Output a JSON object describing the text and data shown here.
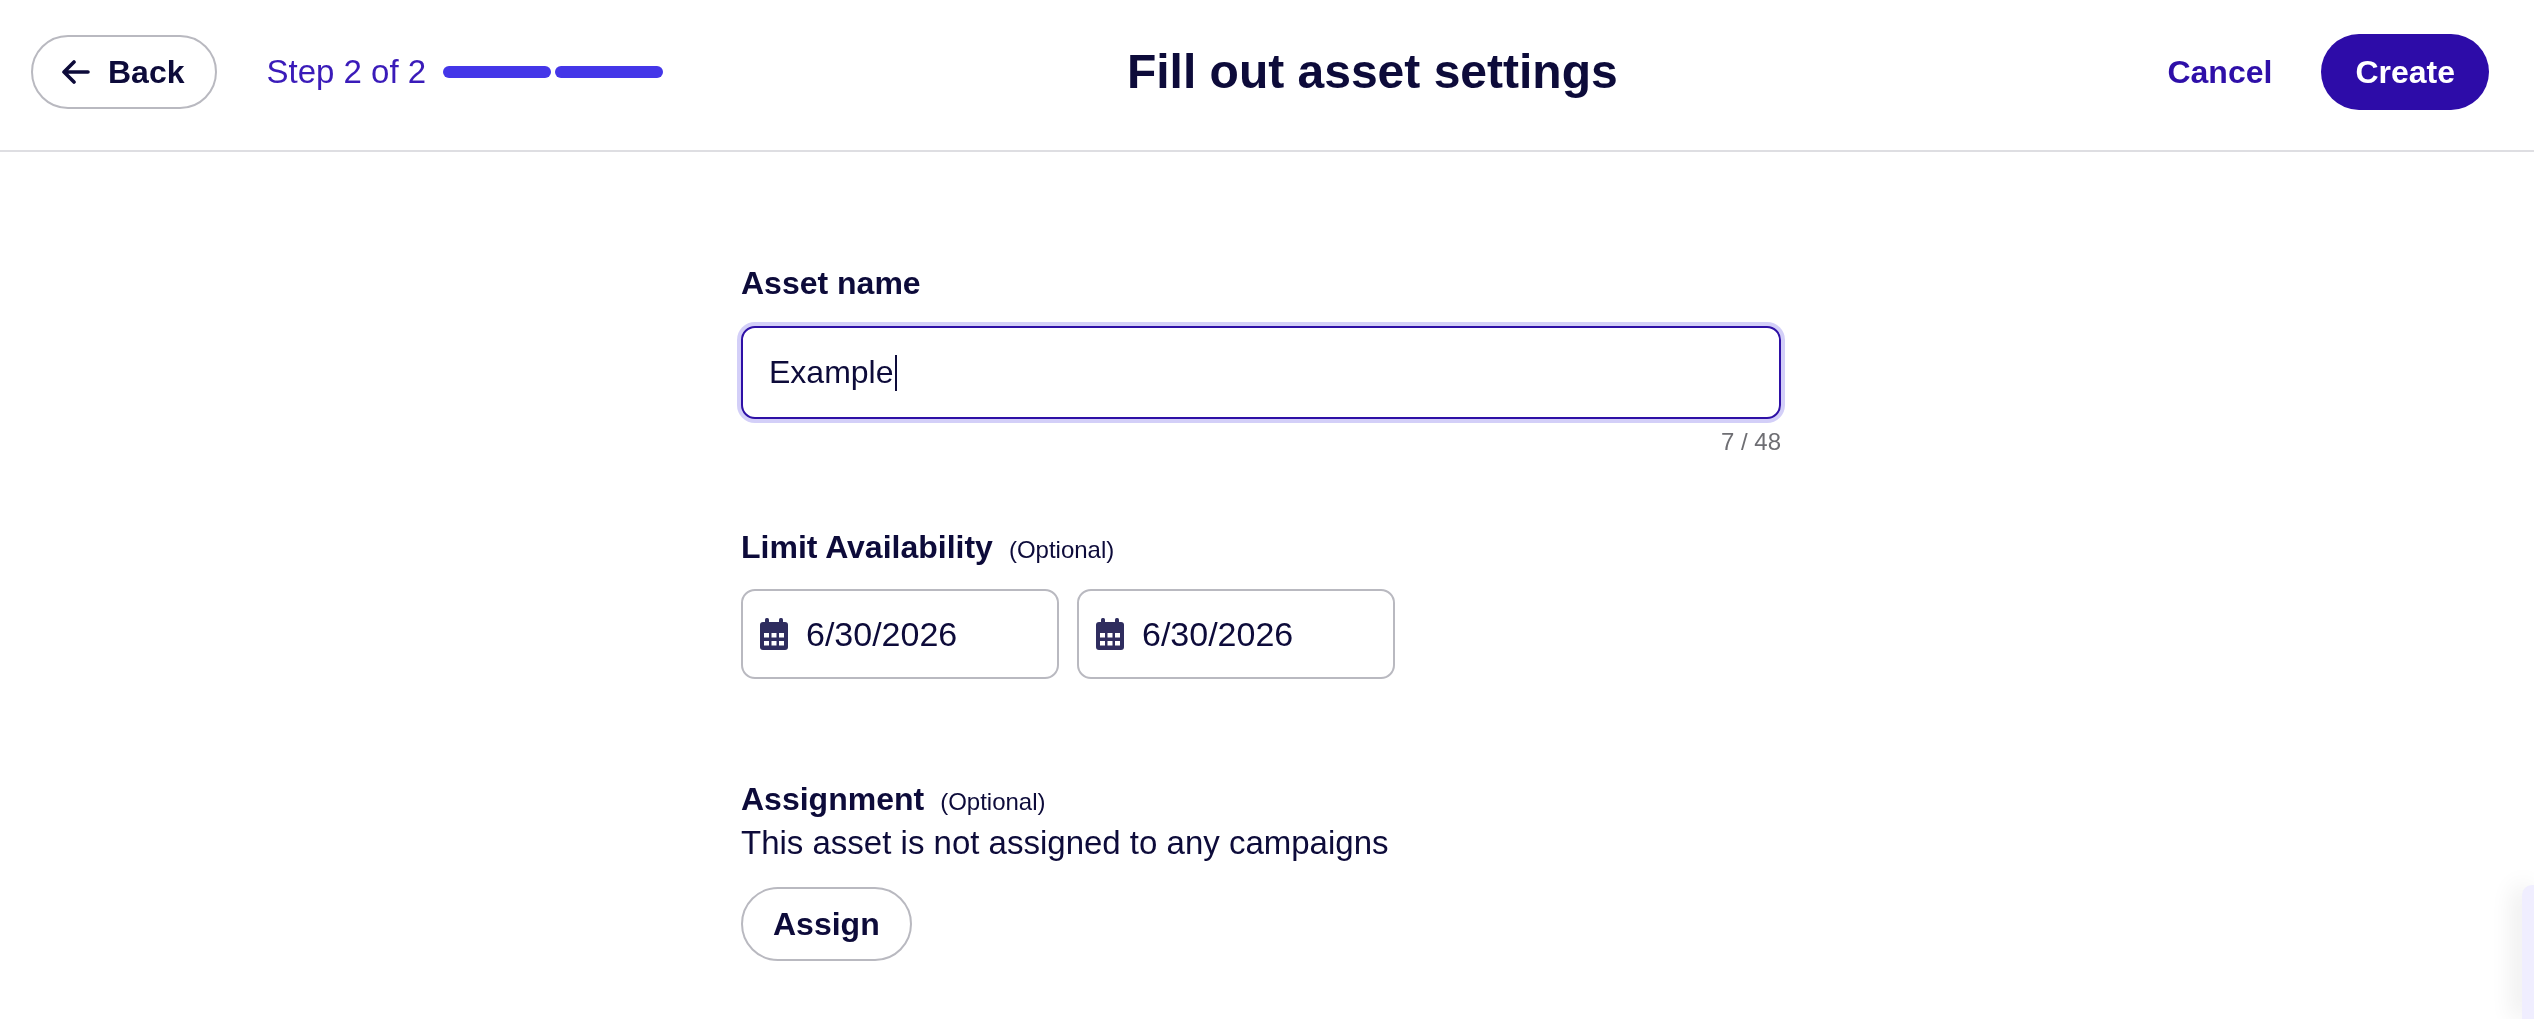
{
  "header": {
    "back_button": {
      "label": "Back"
    },
    "step": {
      "label": "Step 2 of 2",
      "segments": [
        {
          "filled": true
        },
        {
          "filled": true
        }
      ]
    },
    "title": "Fill out asset settings",
    "cancel_button": {
      "label": "Cancel"
    },
    "create_button": {
      "label": "Create"
    }
  },
  "form": {
    "sections": [
      {
        "kind": "text",
        "label": "Asset name",
        "value": "Example",
        "focused": true,
        "counter": "7 / 48"
      },
      {
        "kind": "dates",
        "label": "Limit Availability",
        "note": "(Optional)",
        "dates": [
          "6/30/2026",
          "6/30/2026"
        ]
      },
      {
        "kind": "assign",
        "label": "Assignment",
        "note": "(Optional)",
        "description": "This asset is not assigned to any campaigns",
        "button": "Assign"
      }
    ]
  }
}
